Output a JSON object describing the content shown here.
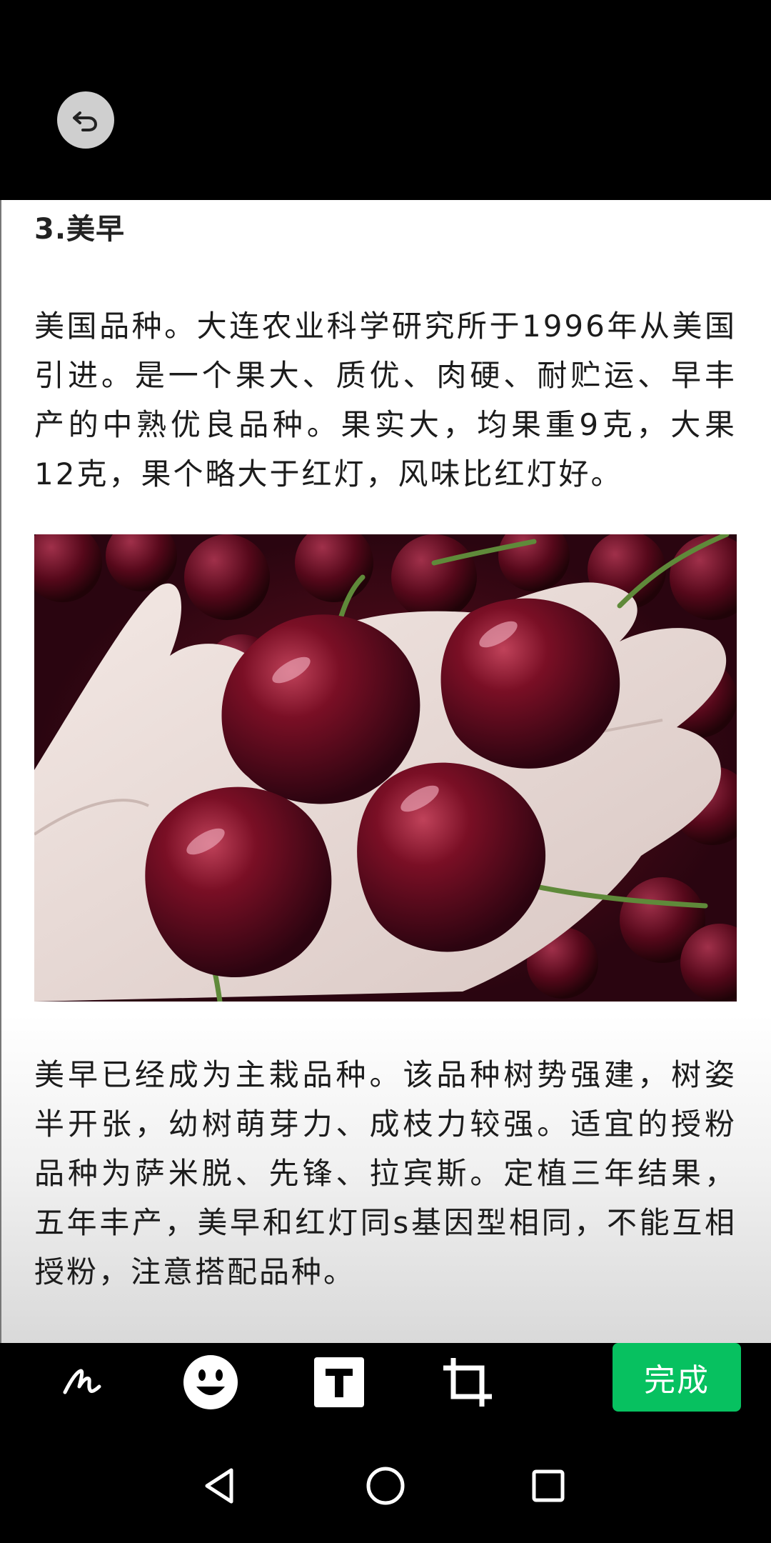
{
  "content": {
    "heading": "3.美早",
    "paragraph1": "美国品种。大连农业科学研究所于1996年从美国引进。是一个果大、质优、肉硬、耐贮运、早丰产的中熟优良品种。果实大，均果重9克，大果12克，果个略大于红灯，风味比红灯好。",
    "paragraph2": "美早已经成为主栽品种。该品种树势强建，树姿半开张，幼树萌芽力、成枝力较强。适宜的授粉品种为萨米脱、先锋、拉宾斯。定植三年结果，五年丰产，美早和红灯同s基因型相同，不能互相授粉，注意搭配品种。"
  },
  "toolbar": {
    "done_label": "完成",
    "tools": [
      "pen-icon",
      "emoji-icon",
      "text-icon",
      "crop-icon"
    ]
  },
  "top_bar": {
    "back_icon": "undo-arrow-icon"
  },
  "navbar": {
    "buttons": [
      "back-triangle-icon",
      "home-circle-icon",
      "recent-apps-square-icon"
    ]
  },
  "colors": {
    "accent": "#07c160",
    "background": "#000000"
  }
}
